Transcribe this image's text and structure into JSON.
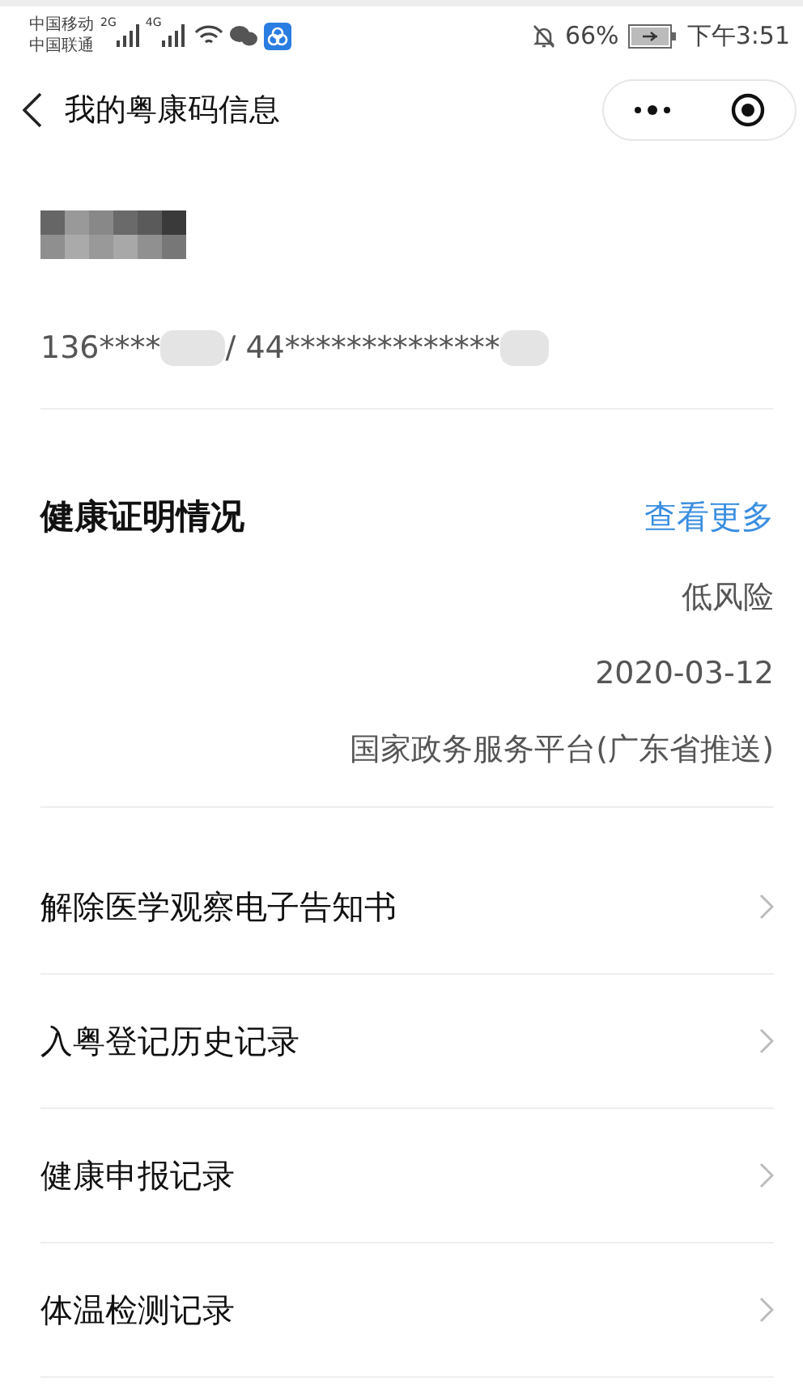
{
  "status_bar": {
    "carriers": [
      "中国移动",
      "中国联通"
    ],
    "networks": [
      "2G",
      "4G"
    ],
    "battery": "66%",
    "time": "下午3:51"
  },
  "header": {
    "title": "我的粤康码信息"
  },
  "profile": {
    "phone": "136****",
    "id_number": "/ 44**************"
  },
  "health": {
    "title": "健康证明情况",
    "more_link": "查看更多",
    "details": [
      "低风险",
      "2020-03-12",
      "国家政务服务平台(广东省推送)"
    ]
  },
  "menu": [
    {
      "label": "解除医学观察电子告知书"
    },
    {
      "label": "入粤登记历史记录"
    },
    {
      "label": "健康申报记录"
    },
    {
      "label": "体温检测记录"
    }
  ]
}
